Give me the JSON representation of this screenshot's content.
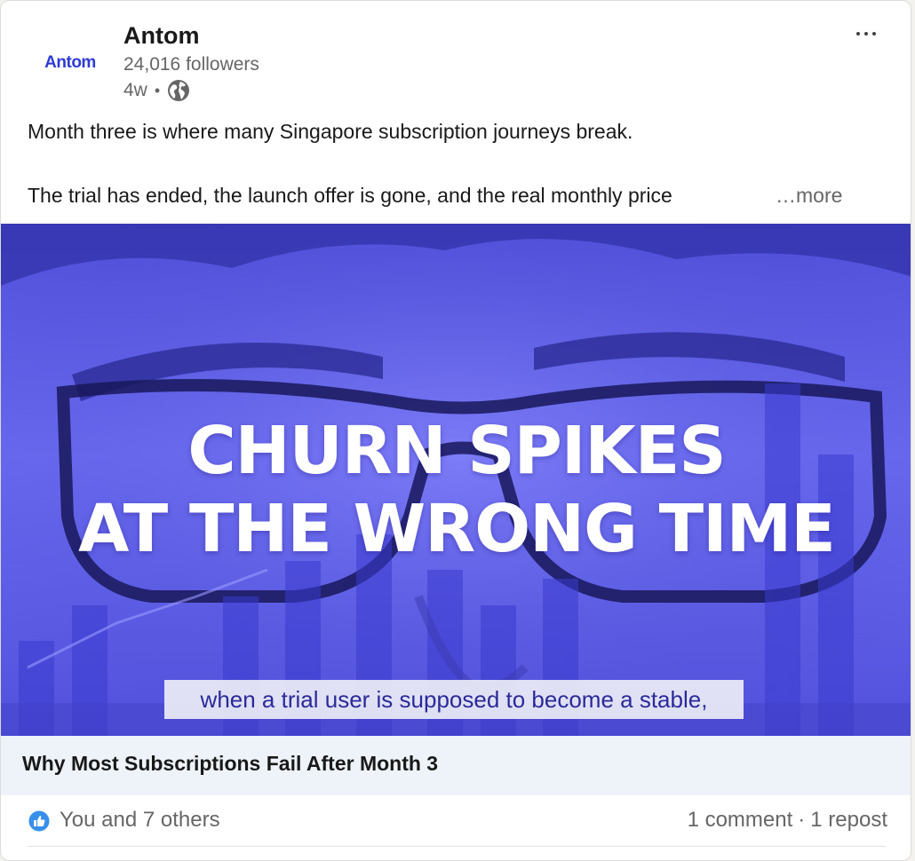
{
  "post": {
    "company_name": "Antom",
    "logo_text": "Antom",
    "followers": "24,016 followers",
    "time_ago": "4w",
    "dot": "•",
    "body_line1": "Month three is where many Singapore subscription journeys break.",
    "body_line2": "The trial has ended, the launch offer is gone, and the real monthly price",
    "see_more": "…more"
  },
  "video": {
    "headline_line1": "CHURN SPIKES",
    "headline_line2": "AT THE WRONG TIME",
    "caption": "when a trial user is supposed to become a stable,"
  },
  "link": {
    "title": "Why Most Subscriptions Fail After Month 3"
  },
  "social": {
    "reactions": "You and 7 others",
    "comments": "1 comment",
    "separator": "·",
    "reposts": "1 repost"
  },
  "colors": {
    "brand_blue": "#2f3bd6",
    "video_tint": "#5a5ae8",
    "link_bar": "#edf3f8",
    "like_blue": "#378fe9"
  },
  "icons": [
    "globe-icon",
    "more-menu-icon",
    "like-icon"
  ]
}
